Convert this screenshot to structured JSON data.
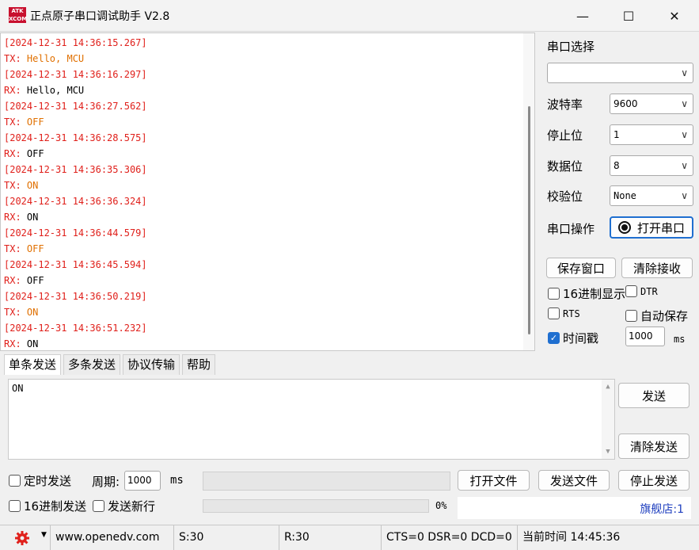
{
  "window": {
    "title": "正点原子串口调试助手 V2.8",
    "logo_text": "ATK XCOM",
    "min_glyph": "—",
    "max_glyph": "☐",
    "close_glyph": "✕"
  },
  "receive": {
    "lines": [
      {
        "kind": "ts",
        "text": "[2024-12-31 14:36:15.267]"
      },
      {
        "kind": "tx",
        "prefix": "TX: ",
        "text": "Hello, MCU"
      },
      {
        "kind": "ts",
        "text": "[2024-12-31 14:36:16.297]"
      },
      {
        "kind": "rx",
        "prefix": "RX: ",
        "text": "Hello, MCU"
      },
      {
        "kind": "ts",
        "text": "[2024-12-31 14:36:27.562]"
      },
      {
        "kind": "tx",
        "prefix": "TX: ",
        "text": "OFF"
      },
      {
        "kind": "ts",
        "text": "[2024-12-31 14:36:28.575]"
      },
      {
        "kind": "rx",
        "prefix": "RX: ",
        "text": "OFF"
      },
      {
        "kind": "ts",
        "text": "[2024-12-31 14:36:35.306]"
      },
      {
        "kind": "tx",
        "prefix": "TX: ",
        "text": "ON"
      },
      {
        "kind": "ts",
        "text": "[2024-12-31 14:36:36.324]"
      },
      {
        "kind": "rx",
        "prefix": "RX: ",
        "text": "ON"
      },
      {
        "kind": "ts",
        "text": "[2024-12-31 14:36:44.579]"
      },
      {
        "kind": "tx",
        "prefix": "TX: ",
        "text": "OFF"
      },
      {
        "kind": "ts",
        "text": "[2024-12-31 14:36:45.594]"
      },
      {
        "kind": "rx",
        "prefix": "RX: ",
        "text": "OFF"
      },
      {
        "kind": "ts",
        "text": "[2024-12-31 14:36:50.219]"
      },
      {
        "kind": "tx",
        "prefix": "TX: ",
        "text": "ON"
      },
      {
        "kind": "ts",
        "text": "[2024-12-31 14:36:51.232]"
      },
      {
        "kind": "rx",
        "prefix": "RX: ",
        "text": "ON"
      }
    ]
  },
  "settings": {
    "port_select_label": "串口选择",
    "port_value": "",
    "baud_label": "波特率",
    "baud_value": "9600",
    "stop_label": "停止位",
    "stop_value": "1",
    "data_label": "数据位",
    "data_value": "8",
    "parity_label": "校验位",
    "parity_value": "None",
    "port_op_label": "串口操作",
    "open_port_label": "打开串口",
    "save_window_label": "保存窗口",
    "clear_recv_label": "清除接收",
    "hex_display_label": "16进制显示",
    "dtr_label": "DTR",
    "rts_label": "RTS",
    "auto_save_label": "自动保存",
    "timestamp_label": "时间戳",
    "timestamp_value": "1000",
    "timestamp_unit": "ms"
  },
  "tabs": [
    "单条发送",
    "多条发送",
    "协议传输",
    "帮助"
  ],
  "send": {
    "text": "ON",
    "send_label": "发送",
    "clear_send_label": "清除发送",
    "timed_send_label": "定时发送",
    "period_label": "周期:",
    "period_value": "1000",
    "period_unit": "ms",
    "open_file_label": "打开文件",
    "send_file_label": "发送文件",
    "stop_send_label": "停止发送",
    "hex_send_label": "16进制发送",
    "send_newline_label": "发送新行",
    "progress_text": "0%",
    "progress": 0,
    "flagship_label": "旗舰店:1"
  },
  "status": {
    "url": "www.openedv.com",
    "sent": "S:30",
    "received": "R:30",
    "lines": "CTS=0 DSR=0 DCD=0",
    "time": "当前时间 14:45:36"
  },
  "colors": {
    "timestamp": "#e0201b",
    "tx": "#e07000",
    "accent": "#1f6fd0",
    "link": "#1f3fbf"
  }
}
